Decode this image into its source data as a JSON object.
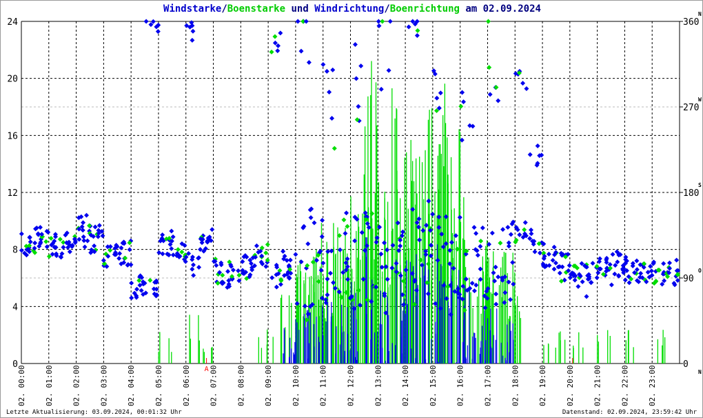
{
  "title": {
    "part1": "Windstarke",
    "sep1": "/",
    "part2": "Boenstarke",
    "mid": " und ",
    "part3": "Windrichtung",
    "sep2": "/",
    "part4": "Boenrichtung",
    "tail": " am 02.09.2024"
  },
  "footer": {
    "left": "Letzte Aktualisierung: 03.09.2024, 00:01:32 Uhr",
    "right": "Datenstand: 02.09.2024, 23:59:42 Uhr"
  },
  "colors": {
    "speed": "#0000ee",
    "gust": "#00dd00",
    "marker": "#ff0000"
  },
  "chart_data": {
    "type": "scatter",
    "title": "Windstarke/Boenstarke und Windrichtung/Boenrichtung am 02.09.2024",
    "left_axis": {
      "ylim": [
        0,
        24
      ],
      "ticks": [
        0,
        4,
        8,
        12,
        16,
        20,
        24
      ]
    },
    "right_axis": {
      "ylim": [
        0,
        360
      ],
      "ticks": [
        0,
        90,
        180,
        270,
        360
      ],
      "compass": [
        "N",
        "O",
        "S",
        "W",
        "N"
      ]
    },
    "x_tick_labels": [
      "02. 00:00",
      "02. 01:00",
      "02. 02:00",
      "02. 03:00",
      "02. 04:00",
      "02. 05:00",
      "02. 06:00",
      "02. 07:00",
      "02. 08:00",
      "02. 09:00",
      "02. 10:00",
      "02. 11:00",
      "02. 12:00",
      "02. 13:00",
      "02. 14:00",
      "02. 15:00",
      "02. 16:00",
      "02. 17:00",
      "02. 18:00",
      "02. 19:00",
      "02. 20:00",
      "02. 21:00",
      "02. 22:00",
      "02. 23:00"
    ],
    "x_hours_step": 0.5,
    "markers": [
      {
        "hour": 6.75,
        "label": "A"
      },
      {
        "hour": 20.1,
        "label": ""
      }
    ],
    "series": [
      {
        "name": "Windstarke",
        "values": [
          8.2,
          9,
          8,
          8.5,
          9.5,
          8.8,
          7.5,
          7.8,
          5.5,
          5.2,
          8.5,
          8,
          7,
          8.5,
          6.5,
          6.2,
          7,
          7.5,
          6,
          7,
          6.5,
          7.5,
          7,
          7.5,
          7,
          7.5,
          7,
          6.5,
          7.5,
          8,
          7,
          7.5,
          7,
          6.5,
          7,
          7.5,
          9,
          8.5,
          7.5,
          7,
          6.5,
          6.5,
          6.5,
          7,
          6.5,
          6.5,
          6.5,
          6.5
        ]
      },
      {
        "name": "Boenstarke",
        "values": [
          0,
          0,
          0,
          0,
          0,
          0,
          0,
          0,
          0,
          0,
          2.5,
          0,
          4,
          2.5,
          0,
          0,
          0,
          2.5,
          5,
          6,
          9,
          10,
          10,
          10,
          14,
          23,
          13,
          20,
          18,
          18,
          20,
          18,
          12,
          10,
          9,
          8,
          5,
          0,
          2.5,
          2.5,
          2.5,
          0,
          2.5,
          0,
          2.5,
          0,
          2.5,
          0
        ]
      },
      {
        "name": "Windrichtung",
        "values": [
          125,
          130,
          125,
          128,
          135,
          125,
          115,
          115,
          80,
          360,
          125,
          115,
          350,
          120,
          95,
          95,
          100,
          110,
          340,
          100,
          355,
          110,
          270,
          100,
          300,
          110,
          320,
          90,
          330,
          100,
          310,
          95,
          280,
          90,
          320,
          100,
          300,
          220,
          110,
          95,
          90,
          80,
          100,
          95,
          100,
          95,
          95,
          90
        ]
      }
    ]
  }
}
